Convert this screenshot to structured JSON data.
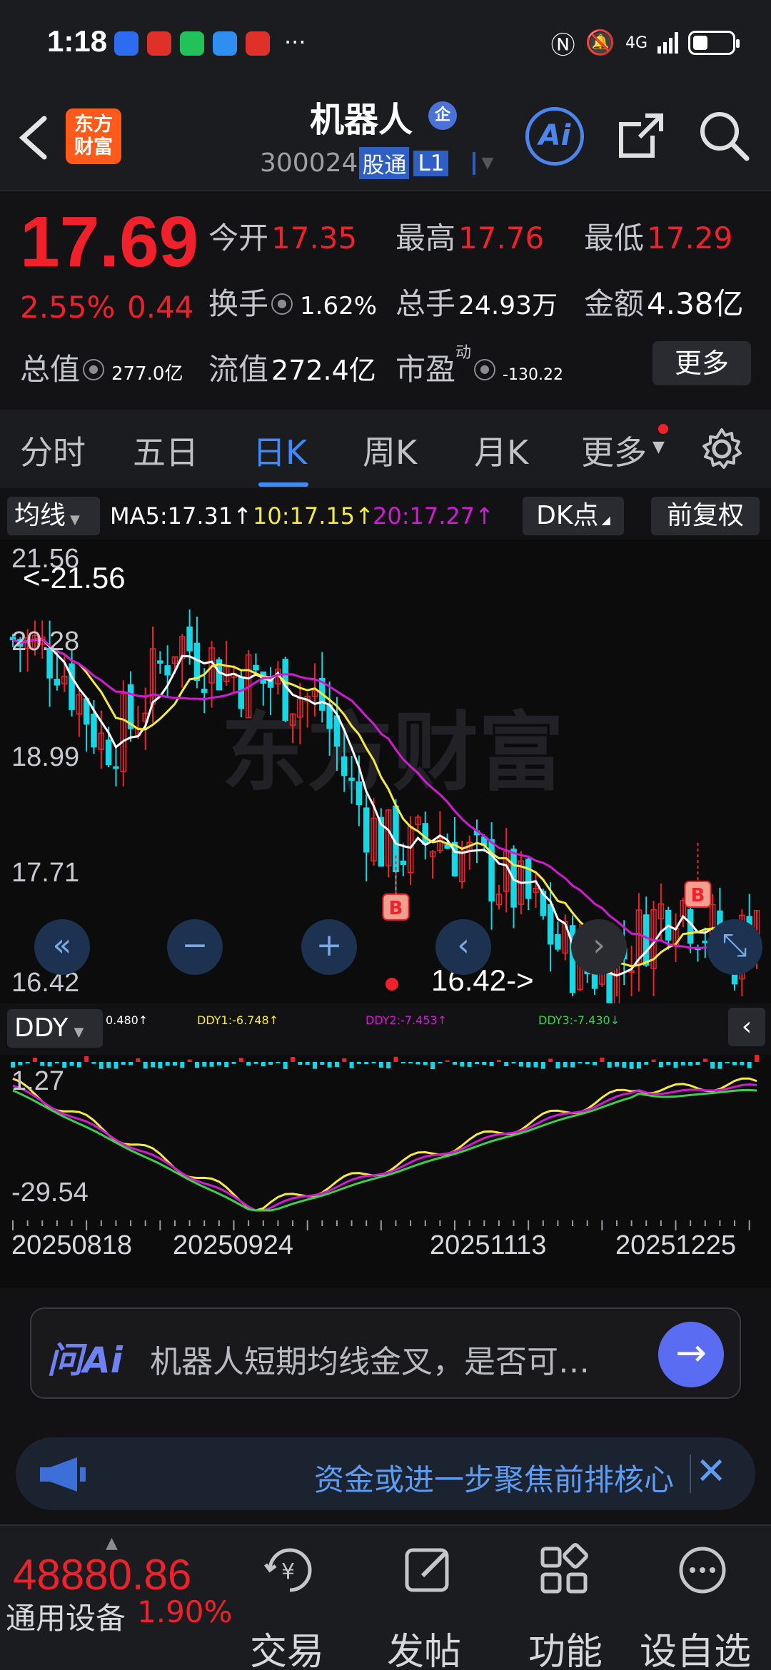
{
  "status_bar": {
    "time": "1:18",
    "more": "···",
    "network": "4G",
    "icons": [
      "nfc-icon",
      "mute-icon",
      "signal-icon",
      "battery-icon"
    ]
  },
  "header": {
    "title": "机器人",
    "badge": "企",
    "code": "300024",
    "tag_hk": "股通",
    "tag_level": "L1",
    "logo_line1": "东方",
    "logo_line2": "财富",
    "ai_label": "Ai"
  },
  "quote": {
    "price": "17.69",
    "change_pct": "2.55%",
    "change_abs": "0.44",
    "open_label": "今开",
    "open": "17.35",
    "high_label": "最高",
    "high": "17.76",
    "low_label": "最低",
    "low": "17.29",
    "turnover_label": "换手",
    "turnover": "1.62%",
    "volume_label": "总手",
    "volume": "24.93万",
    "amount_label": "金额",
    "amount": "4.38亿",
    "mktcap_label": "总值",
    "mktcap": "277.0亿",
    "float_label": "流值",
    "float": "272.4亿",
    "pe_label": "市盈",
    "pe_sup": "动",
    "pe": "-130.22",
    "more_label": "更多"
  },
  "tabs": {
    "items": [
      "分时",
      "五日",
      "日K",
      "周K",
      "月K",
      "更多"
    ],
    "active": "日K"
  },
  "ma_row": {
    "select": "均线",
    "ma5": "MA5:17.31↑",
    "ma10": "10:17.15↑",
    "ma20": "20:17.27↑",
    "dk": "DK点",
    "adjust": "前复权"
  },
  "kline": {
    "axis": [
      "21.56",
      "20.28",
      "18.99",
      "17.71",
      "16.42"
    ],
    "max_note": "<-21.56",
    "min_note": "16.42->",
    "signal_label": "B",
    "watermark": "东方财富"
  },
  "ddy_row": {
    "select": "DDY",
    "ddy": "0.480↑",
    "ddy1": "DDY1:-6.748↑",
    "ddy2": "DDY2:-7.453↑",
    "ddy3": "DDY3:-7.430↓"
  },
  "ddy_axis": [
    "1.27",
    "-29.54"
  ],
  "dates": [
    "20250818",
    "20250924",
    "20251113",
    "20251225"
  ],
  "ask": {
    "logo": "问Ai",
    "question": "机器人短期均线金叉，是否可…"
  },
  "news": {
    "text": "资金或进一步聚焦前排核心"
  },
  "bottom": {
    "index_value": "48880.86",
    "index_name": "通用设备",
    "index_pct": "1.90%",
    "nav": [
      "交易",
      "发帖",
      "功能",
      "设自选"
    ]
  },
  "colors": {
    "up": "#f2202a",
    "down": "#15d8e6",
    "ma5": "#ffffff",
    "ma10": "#f5ea3d",
    "ma20": "#d31ad3",
    "ddy3": "#3ccf4e",
    "accent": "#3d8bff"
  }
}
